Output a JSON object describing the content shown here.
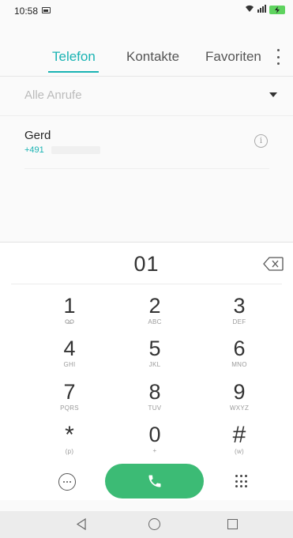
{
  "status": {
    "time": "10:58",
    "icons": [
      "image-icon",
      "wifi-icon",
      "signal-icon",
      "battery-charging-icon"
    ]
  },
  "tabs": [
    {
      "label": "Telefon",
      "active": true
    },
    {
      "label": "Kontakte",
      "active": false
    },
    {
      "label": "Favoriten",
      "active": false
    }
  ],
  "filter": {
    "label": "Alle Anrufe"
  },
  "calls": [
    {
      "name": "Gerd",
      "number": "+491"
    }
  ],
  "dialer": {
    "display": "01",
    "keys": [
      {
        "num": "1",
        "sub": "voicemail-icon"
      },
      {
        "num": "2",
        "sub": "ABC"
      },
      {
        "num": "3",
        "sub": "DEF"
      },
      {
        "num": "4",
        "sub": "GHI"
      },
      {
        "num": "5",
        "sub": "JKL"
      },
      {
        "num": "6",
        "sub": "MNO"
      },
      {
        "num": "7",
        "sub": "PQRS"
      },
      {
        "num": "8",
        "sub": "TUV"
      },
      {
        "num": "9",
        "sub": "WXYZ"
      },
      {
        "num": "*",
        "sub": "(p)"
      },
      {
        "num": "0",
        "sub": "+"
      },
      {
        "num": "#",
        "sub": "(w)"
      }
    ]
  },
  "colors": {
    "accent": "#19b3b3",
    "call": "#3cbb75"
  }
}
